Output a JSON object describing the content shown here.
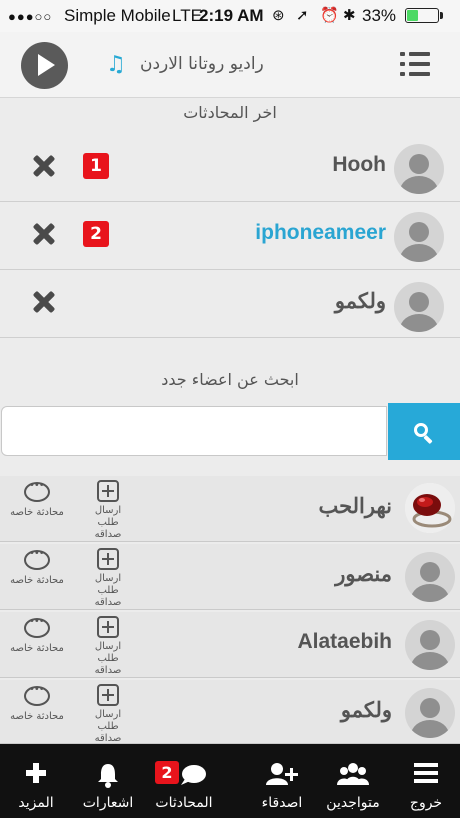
{
  "status_bar": {
    "signal": "●●●○○",
    "carrier": "Simple Mobile",
    "network": "LTE",
    "time": "2:19 AM",
    "battery": "33%",
    "battery_level": 0.33
  },
  "header": {
    "radio_title": "راديو روتانا الاردن",
    "play_icon": "play-icon",
    "menu_icon": "menu-icon",
    "music_icon": "♫"
  },
  "recent_chats": {
    "title": "اخر المحادثات",
    "items": [
      {
        "name": "Hooh",
        "badge": "1",
        "highlighted": false
      },
      {
        "name": "iphoneameer",
        "badge": "2",
        "highlighted": true
      },
      {
        "name": "ولكمو",
        "badge": "",
        "highlighted": false
      }
    ]
  },
  "search": {
    "title": "ابحث عن اعضاء جدد",
    "placeholder": "",
    "value": ""
  },
  "members": {
    "private_chat_label": "محادثة خاصه",
    "friend_request_label": "ارسال طلب صداقه",
    "items": [
      {
        "name": "نهرالحب",
        "avatar": "photo"
      },
      {
        "name": "منصور",
        "avatar": "default"
      },
      {
        "name": "Alataebih",
        "avatar": "default"
      },
      {
        "name": "ولكمو",
        "avatar": "default"
      }
    ]
  },
  "tabbar": {
    "more": "المزيد",
    "notifications": "اشعارات",
    "chats": "المحادثات",
    "chats_badge": "2",
    "friends": "اصدقاء",
    "online": "متواجدين",
    "logout": "خروج"
  },
  "colors": {
    "accent": "#27a9d8",
    "badge": "#e8141c",
    "tabbar": "#111111"
  }
}
